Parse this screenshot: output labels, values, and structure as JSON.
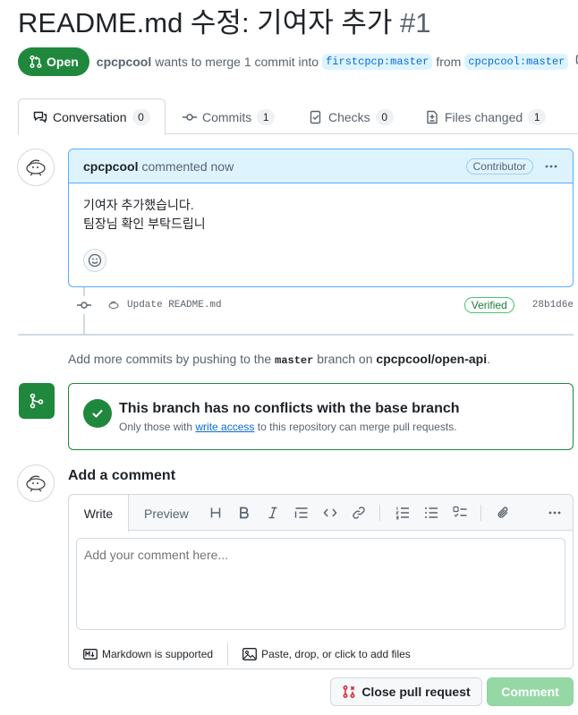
{
  "pr": {
    "title": "README.md 수정: 기여자 추가",
    "number": "#1",
    "state": "Open",
    "author": "cpcpcool",
    "merge_text_1": "wants to merge 1 commit into",
    "base_branch": "firstcpcp:master",
    "from_text": "from",
    "head_branch": "cpcpcool:master"
  },
  "tabs": [
    {
      "label": "Conversation",
      "count": "0"
    },
    {
      "label": "Commits",
      "count": "1"
    },
    {
      "label": "Checks",
      "count": "0"
    },
    {
      "label": "Files changed",
      "count": "1"
    }
  ],
  "comment": {
    "author": "cpcpcool",
    "action": "commented now",
    "badge": "Contributor",
    "line1": "기여자 추가했습니다.",
    "line2": "팀장님 확인 부탁드립니"
  },
  "commit": {
    "message": "Update README.md",
    "verified": "Verified",
    "sha": "28b1d6e"
  },
  "hint": {
    "prefix": "Add more commits by pushing to the",
    "branch": "master",
    "middle": "branch on",
    "repo": "cpcpcool/open-api",
    "suffix": "."
  },
  "merge": {
    "title": "This branch has no conflicts with the base branch",
    "sub_prefix": "Only those with",
    "sub_link": "write access",
    "sub_suffix": "to this repository can merge pull requests."
  },
  "add_comment": {
    "heading": "Add a comment",
    "tab_write": "Write",
    "tab_preview": "Preview",
    "placeholder": "Add your comment here...",
    "markdown_note": "Markdown is supported",
    "files_note": "Paste, drop, or click to add files"
  },
  "buttons": {
    "close": "Close pull request",
    "comment": "Comment"
  },
  "colors": {
    "open_green": "#1f883d",
    "link_blue": "#0969da",
    "comment_head_bg": "#ddf4ff",
    "comment_button_disabled": "#95d8a6",
    "close_icon_red": "#d1242f"
  }
}
